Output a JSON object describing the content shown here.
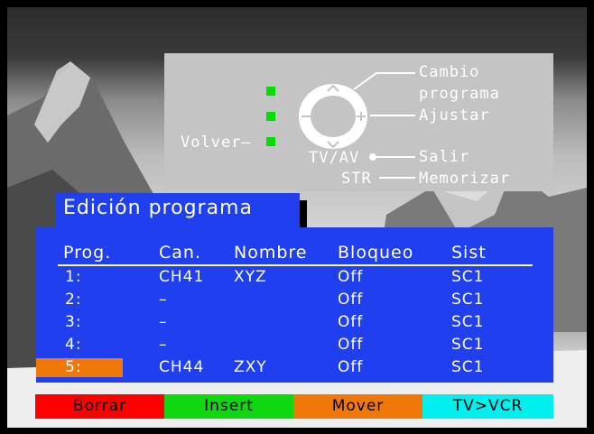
{
  "help": {
    "cambio_line1": "Cambio",
    "cambio_line2": "programa",
    "ajustar": "Ajustar",
    "volver": "Volver",
    "tvav": "TV/AV",
    "salir": "Salir",
    "str": "STR",
    "memorizar": "Memorizar"
  },
  "title": "Edición programa",
  "table": {
    "headers": [
      "Prog.",
      "Can.",
      "Nombre",
      "Bloqueo",
      "Sist"
    ],
    "rows": [
      {
        "prog": "1:",
        "can": "CH41",
        "nombre": "XYZ",
        "bloqueo": "Off",
        "sist": "SC1"
      },
      {
        "prog": "2:",
        "can": "–",
        "nombre": "",
        "bloqueo": "Off",
        "sist": "SC1"
      },
      {
        "prog": "3:",
        "can": "–",
        "nombre": "",
        "bloqueo": "Off",
        "sist": "SC1"
      },
      {
        "prog": "4:",
        "can": "–",
        "nombre": "",
        "bloqueo": "Off",
        "sist": "SC1"
      },
      {
        "prog": "5:",
        "can": "CH44",
        "nombre": "ZXY",
        "bloqueo": "Off",
        "sist": "SC1"
      }
    ],
    "selected_row": 5
  },
  "buttons": [
    {
      "label": "Borrar",
      "color": "#ff0000"
    },
    {
      "label": "Insert",
      "color": "#10d810"
    },
    {
      "label": "Mover",
      "color": "#f07808"
    },
    {
      "label": "TV>VCR",
      "color": "#00f0f0"
    }
  ],
  "colors": {
    "panel": "#2040f0",
    "indicator": "#00e000",
    "selection": "#f07808"
  }
}
